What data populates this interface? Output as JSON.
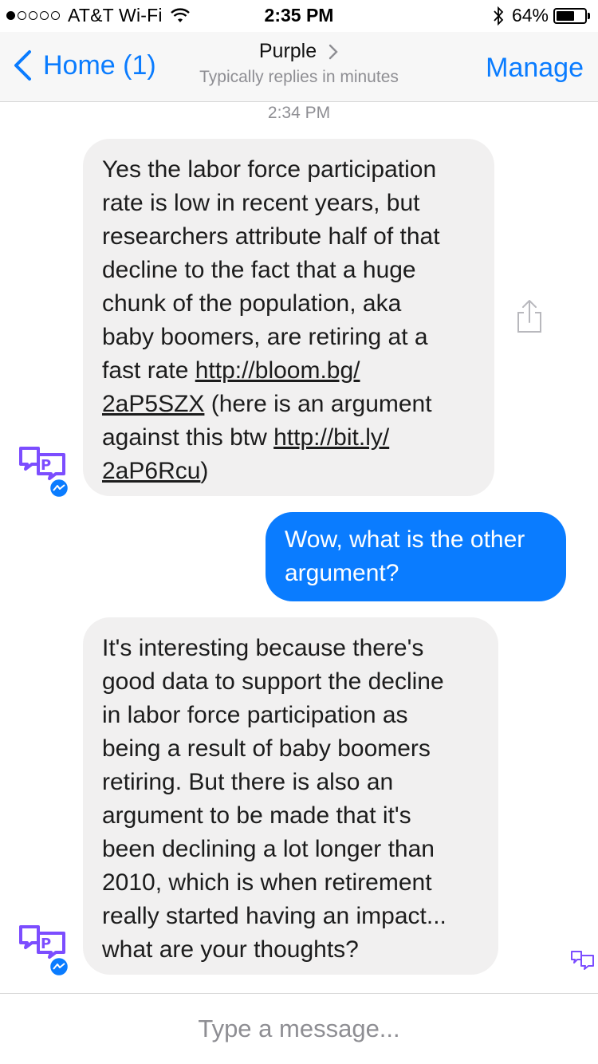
{
  "status_bar": {
    "carrier": "AT&T Wi-Fi",
    "time": "2:35 PM",
    "battery": "64%",
    "battery_level": 0.64,
    "signal_bars": 1,
    "icons": [
      "signal-dots-icon",
      "wifi-icon",
      "bluetooth-icon",
      "battery-icon"
    ]
  },
  "nav": {
    "back_label": "Home (1)",
    "title": "Purple",
    "subtitle": "Typically replies in minutes",
    "action_label": "Manage",
    "accent": "#0a7cff"
  },
  "chat": {
    "timestamp": "2:34 PM",
    "messages": [
      {
        "direction": "incoming",
        "lines": [
          "Yes the labor force participation",
          "rate is low in recent years, but",
          "researchers attribute half of that",
          "decline to the fact that a huge",
          "chunk of the population, aka",
          "baby boomers, are retiring at a"
        ],
        "line7_prefix": "fast rate ",
        "link1_part1": "http://bloom.bg/",
        "link1_part2": "2aP5SZX",
        "line8_suffix": " (here is an argument",
        "line9_prefix": "against this btw ",
        "link2_part1": "http://bit.ly/",
        "link2_part2": "2aP6Rcu",
        "line10_suffix": ")"
      },
      {
        "direction": "outgoing",
        "lines": [
          "Wow, what is the other",
          "argument?"
        ],
        "color": "#0a7cff"
      },
      {
        "direction": "incoming",
        "lines": [
          "It's interesting because there's",
          "good data to support the decline",
          "in labor force participation as",
          "being a result of baby boomers",
          "retiring. But there is also an",
          "argument to be made that it's",
          "been declining a lot longer than",
          "2010, which is when retirement",
          "really started having an impact...",
          "what are your thoughts?"
        ]
      }
    ],
    "avatar_colors": {
      "bot": "#7c4dff",
      "badge": "#0a7cff"
    }
  },
  "composer": {
    "placeholder": "Type a message..."
  }
}
